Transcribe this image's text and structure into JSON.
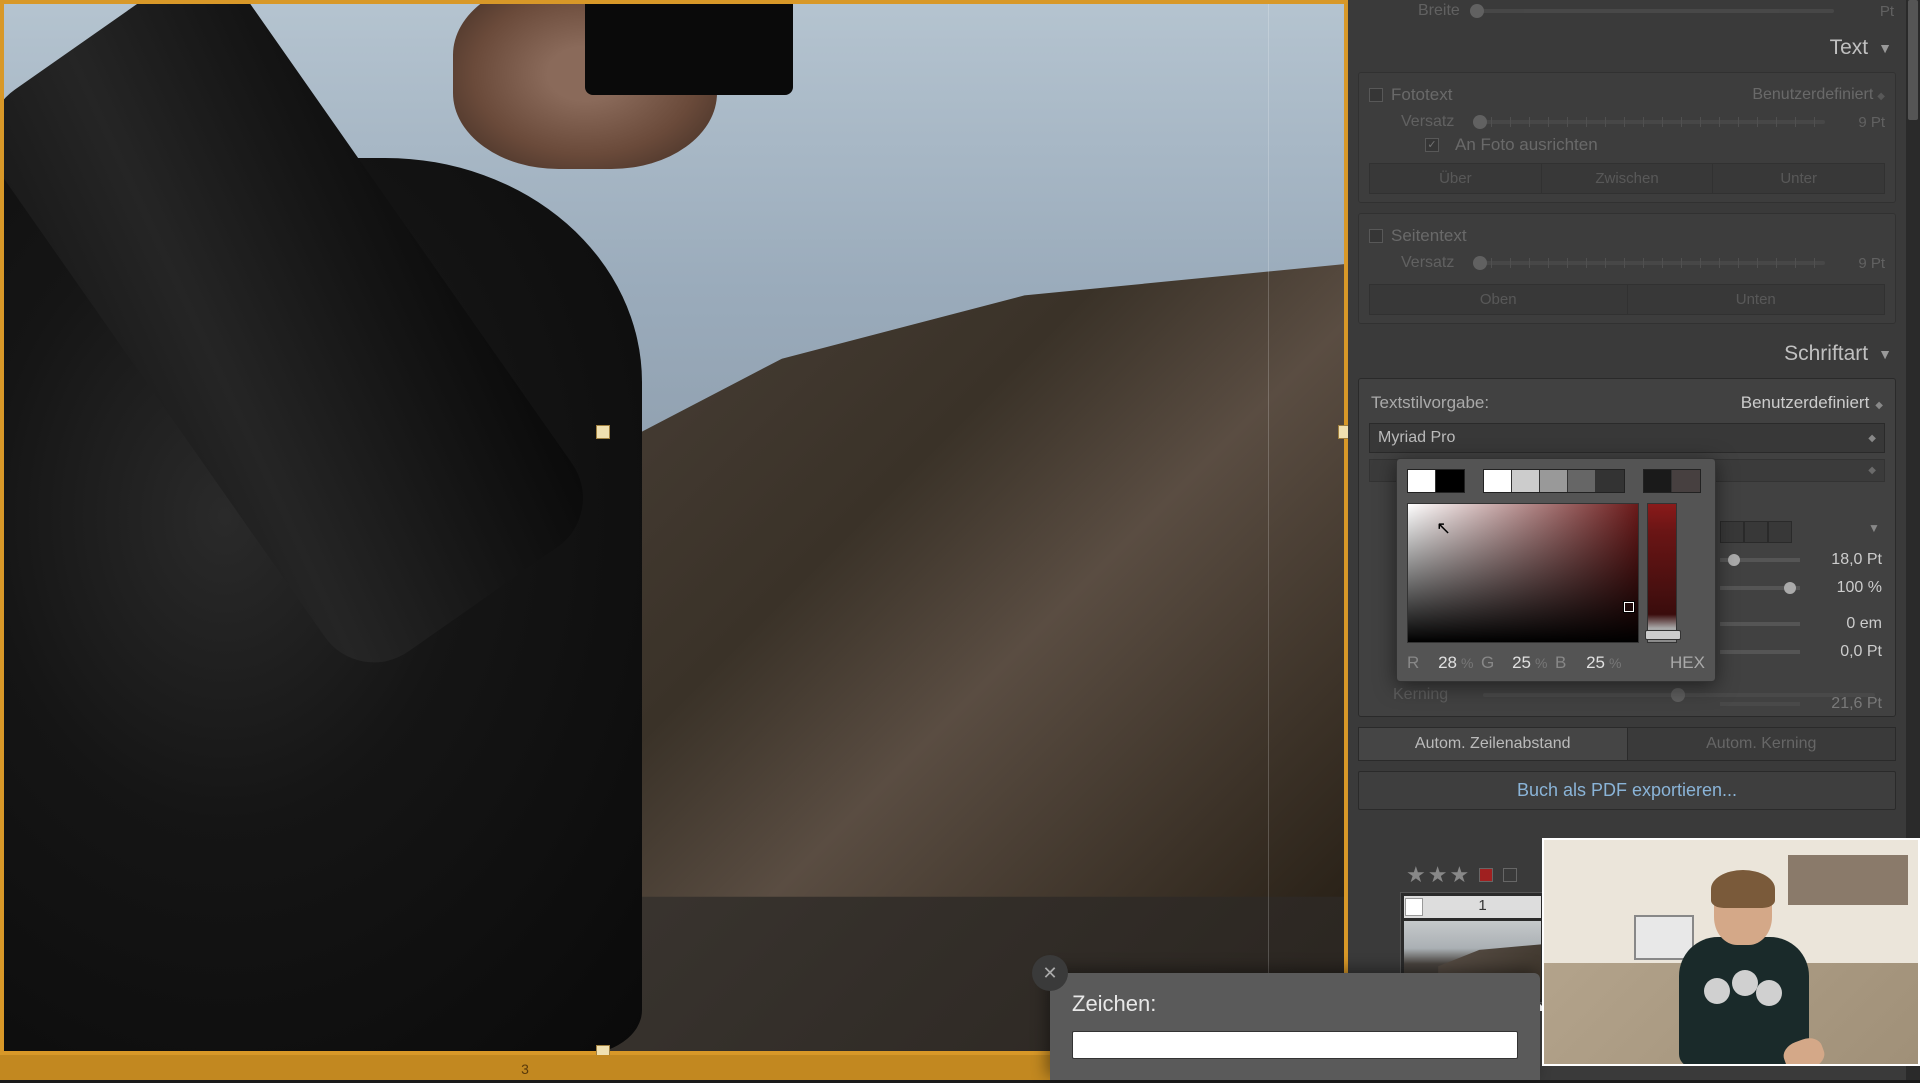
{
  "panels": {
    "breite": {
      "label": "Breite",
      "value": "Pt"
    },
    "text_header": "Text",
    "fototext": {
      "label": "Fototext",
      "preset": "Benutzerdefiniert",
      "versatz_label": "Versatz",
      "versatz_value": "9 Pt",
      "align_label": "An Foto ausrichten",
      "seg1": "Über",
      "seg2": "Zwischen",
      "seg3": "Unter"
    },
    "seitentext": {
      "label": "Seitentext",
      "versatz_label": "Versatz",
      "versatz_value": "9 Pt",
      "seg1": "Oben",
      "seg2": "Unten"
    },
    "schriftart_header": "Schriftart",
    "textstil": {
      "label": "Textstilvorgabe:",
      "value": "Benutzerdefiniert"
    },
    "font_name": "Myriad Pro",
    "metrics": {
      "size": "18,0 Pt",
      "opacity": "100 %",
      "tracking": "0 em",
      "baseline": "0,0 Pt",
      "leading": "21,6 Pt"
    },
    "kerning_label": "Kerning",
    "auto_leading": "Autom. Zeilenabstand",
    "auto_kerning": "Autom. Kerning",
    "export": "Buch als PDF exportieren..."
  },
  "color_picker": {
    "swatches_main": [
      "#ffffff",
      "#000000"
    ],
    "swatches_grays": [
      "#ffffff",
      "#cccccc",
      "#999999",
      "#666666",
      "#333333"
    ],
    "swatches_current": [
      "#1a1a1a",
      "#474040"
    ],
    "r_label": "R",
    "r_value": "28",
    "g_label": "G",
    "g_value": "25",
    "b_label": "B",
    "b_value": "25",
    "pct": "%",
    "hex_label": "HEX"
  },
  "filmstrip": {
    "page_number": "1"
  },
  "zeichen": {
    "title": "Zeichen:"
  },
  "page_indicator": "3"
}
